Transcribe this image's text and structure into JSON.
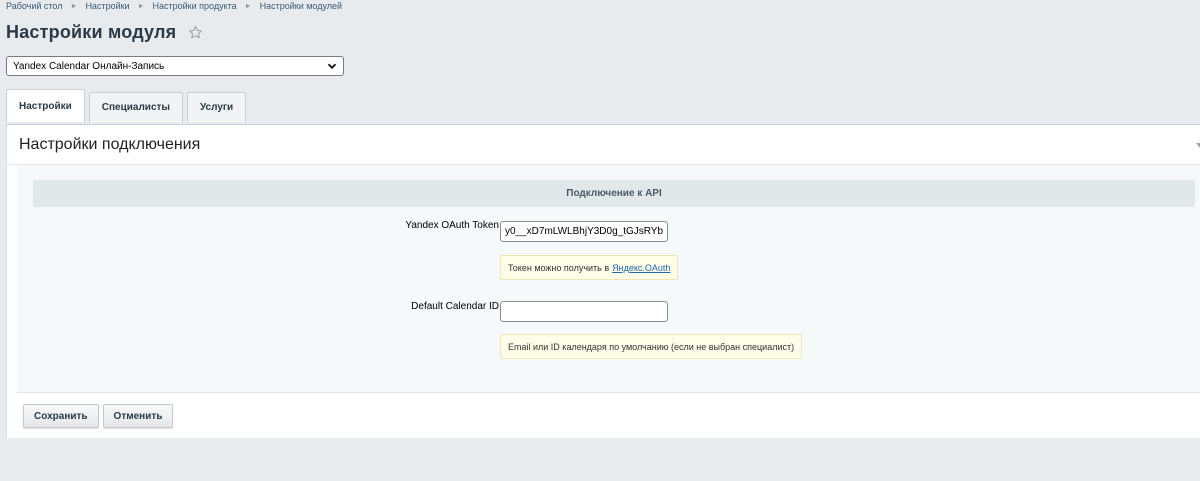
{
  "breadcrumb": [
    "Рабочий стол",
    "Настройки",
    "Настройки продукта",
    "Настройки модулей"
  ],
  "page_title": "Настройки модуля",
  "module_select": {
    "value": "Yandex Calendar Онлайн-Запись"
  },
  "tabs": [
    {
      "label": "Настройки",
      "active": true
    },
    {
      "label": "Специалисты",
      "active": false
    },
    {
      "label": "Услуги",
      "active": false
    }
  ],
  "panel": {
    "title": "Настройки подключения",
    "section_title": "Подключение к API",
    "fields": [
      {
        "label": "Yandex OAuth Token",
        "value": "y0__xD7mLWLBhjY3D0g_tGJsRYb",
        "hint_text": "Токен можно получить в",
        "hint_link": "Яндекс.OAuth"
      },
      {
        "label": "Default Calendar ID",
        "value": "",
        "hint_text": "Email или ID календаря по умолчанию (если не выбран специалист)"
      }
    ]
  },
  "buttons": {
    "save": "Сохранить",
    "cancel": "Отменить"
  },
  "colors": {
    "page_bg": "#e7ebed",
    "section_head_bg": "#e0e8ea",
    "hint_bg": "#fefde8",
    "link": "#2067b0"
  }
}
